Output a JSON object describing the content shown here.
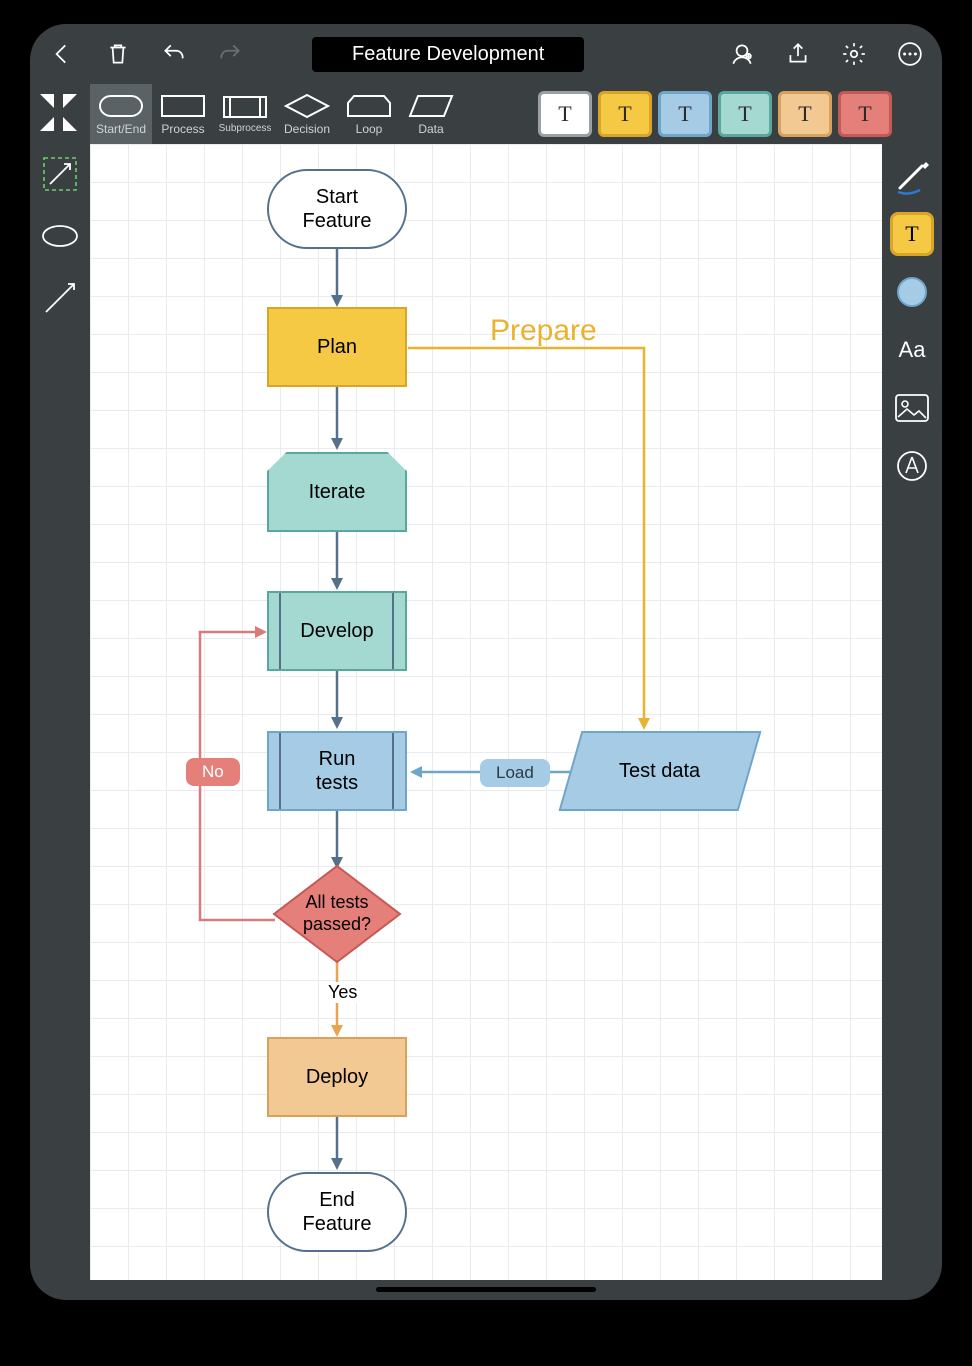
{
  "title": "Feature Development",
  "shape_palette": {
    "start_end": "Start/End",
    "process": "Process",
    "subprocess": "Subprocess",
    "decision": "Decision",
    "loop": "Loop",
    "data": "Data"
  },
  "swatches": [
    {
      "bg": "#ffffff",
      "border": "#9aa0a3",
      "glyph": "T",
      "text": "#2a2a2a"
    },
    {
      "bg": "#f5c944",
      "border": "#d9a526",
      "glyph": "T",
      "text": "#2a2a2a"
    },
    {
      "bg": "#a6cbe5",
      "border": "#6fa5c8",
      "glyph": "T",
      "text": "#2a2a2a"
    },
    {
      "bg": "#a4d9d2",
      "border": "#5aa79e",
      "glyph": "T",
      "text": "#2a2a2a"
    },
    {
      "bg": "#f2c893",
      "border": "#d9a05e",
      "glyph": "T",
      "text": "#2a2a2a"
    },
    {
      "bg": "#e57f79",
      "border": "#c45a55",
      "glyph": "T",
      "text": "#2a2a2a"
    }
  ],
  "right_tools": {
    "swatch": {
      "bg": "#f5c944",
      "border": "#d9a526",
      "glyph": "T"
    },
    "text": "Aa"
  },
  "nodes": {
    "start": {
      "label": "Start\nFeature"
    },
    "plan": {
      "label": "Plan"
    },
    "iterate": {
      "label": "Iterate"
    },
    "develop": {
      "label": "Develop"
    },
    "runtests": {
      "label": "Run\ntests"
    },
    "decision": {
      "label": "All tests\npassed?"
    },
    "deploy": {
      "label": "Deploy"
    },
    "end": {
      "label": "End\nFeature"
    },
    "testdata": {
      "label": "Test data"
    }
  },
  "edge_labels": {
    "prepare": "Prepare",
    "load": "Load",
    "yes": "Yes",
    "no": "No"
  },
  "colors": {
    "plan_fill": "#f5c944",
    "plan_stroke": "#d9a526",
    "iterate_fill": "#a4d9d2",
    "iterate_stroke": "#5aa79e",
    "develop_fill": "#a4d9d2",
    "develop_stroke": "#5aa79e",
    "runtests_fill": "#a6cbe5",
    "runtests_stroke": "#6fa5c8",
    "decision_fill": "#e57f79",
    "decision_stroke": "#c45a55",
    "deploy_fill": "#f2c893",
    "deploy_stroke": "#d9a05e",
    "no_badge": "#e57f79",
    "load_badge": "#a6cbe5",
    "prepare_text": "#e8b330"
  },
  "chart_data": {
    "type": "flowchart",
    "nodes": [
      {
        "id": "start",
        "shape": "terminator",
        "label": "Start Feature"
      },
      {
        "id": "plan",
        "shape": "process",
        "label": "Plan",
        "fill": "yellow"
      },
      {
        "id": "iterate",
        "shape": "loop",
        "label": "Iterate",
        "fill": "teal"
      },
      {
        "id": "develop",
        "shape": "subprocess",
        "label": "Develop",
        "fill": "teal"
      },
      {
        "id": "runtests",
        "shape": "subprocess",
        "label": "Run tests",
        "fill": "blue"
      },
      {
        "id": "testdata",
        "shape": "data",
        "label": "Test data",
        "fill": "blue"
      },
      {
        "id": "decision",
        "shape": "decision",
        "label": "All tests passed?",
        "fill": "red"
      },
      {
        "id": "deploy",
        "shape": "process",
        "label": "Deploy",
        "fill": "orange"
      },
      {
        "id": "end",
        "shape": "terminator",
        "label": "End Feature"
      }
    ],
    "edges": [
      {
        "from": "start",
        "to": "plan"
      },
      {
        "from": "plan",
        "to": "iterate"
      },
      {
        "from": "plan",
        "to": "testdata",
        "label": "Prepare",
        "color": "yellow"
      },
      {
        "from": "iterate",
        "to": "develop"
      },
      {
        "from": "develop",
        "to": "runtests"
      },
      {
        "from": "testdata",
        "to": "runtests",
        "label": "Load",
        "color": "blue"
      },
      {
        "from": "runtests",
        "to": "decision"
      },
      {
        "from": "decision",
        "to": "develop",
        "label": "No",
        "color": "red"
      },
      {
        "from": "decision",
        "to": "deploy",
        "label": "Yes",
        "color": "orange"
      },
      {
        "from": "deploy",
        "to": "end"
      }
    ]
  }
}
